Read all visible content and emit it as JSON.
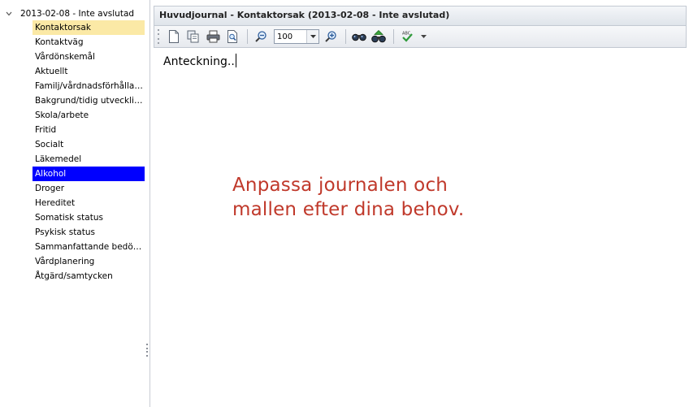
{
  "tree": {
    "root_label": "2013-02-08 - Inte avslutad",
    "items": [
      {
        "label": "Kontaktorsak",
        "state": "current"
      },
      {
        "label": "Kontaktväg",
        "state": ""
      },
      {
        "label": "Vårdönskemål",
        "state": ""
      },
      {
        "label": "Aktuellt",
        "state": ""
      },
      {
        "label": "Familj/vårdnadsförhållan...",
        "state": ""
      },
      {
        "label": "Bakgrund/tidig utveckling",
        "state": ""
      },
      {
        "label": "Skola/arbete",
        "state": ""
      },
      {
        "label": "Fritid",
        "state": ""
      },
      {
        "label": "Socialt",
        "state": ""
      },
      {
        "label": "Läkemedel",
        "state": ""
      },
      {
        "label": "Alkohol",
        "state": "selected"
      },
      {
        "label": "Droger",
        "state": ""
      },
      {
        "label": "Hereditet",
        "state": ""
      },
      {
        "label": "Somatisk status",
        "state": ""
      },
      {
        "label": "Psykisk status",
        "state": ""
      },
      {
        "label": "Sammanfattande bedöm...",
        "state": ""
      },
      {
        "label": "Vårdplanering",
        "state": ""
      },
      {
        "label": "Åtgärd/samtycken",
        "state": ""
      }
    ]
  },
  "editor": {
    "title": "Huvudjournal - Kontaktorsak (2013-02-08 - Inte avslutad)",
    "zoom_value": "100",
    "document_text": "Anteckning..",
    "overlay_lines": [
      "Anpassa journalen och",
      "mallen efter dina behov."
    ]
  },
  "colors": {
    "current_highlight": "#fbe9a6",
    "selected_highlight": "#0000ff",
    "overlay_text": "#c0392b"
  },
  "icons": {
    "toolbar": [
      "new-document-icon",
      "copy-pages-icon",
      "print-icon",
      "print-preview-icon",
      "zoom-out-icon",
      "zoom-in-icon",
      "find-icon",
      "find-next-icon",
      "spell-check-icon",
      "toolbar-overflow-icon"
    ]
  }
}
